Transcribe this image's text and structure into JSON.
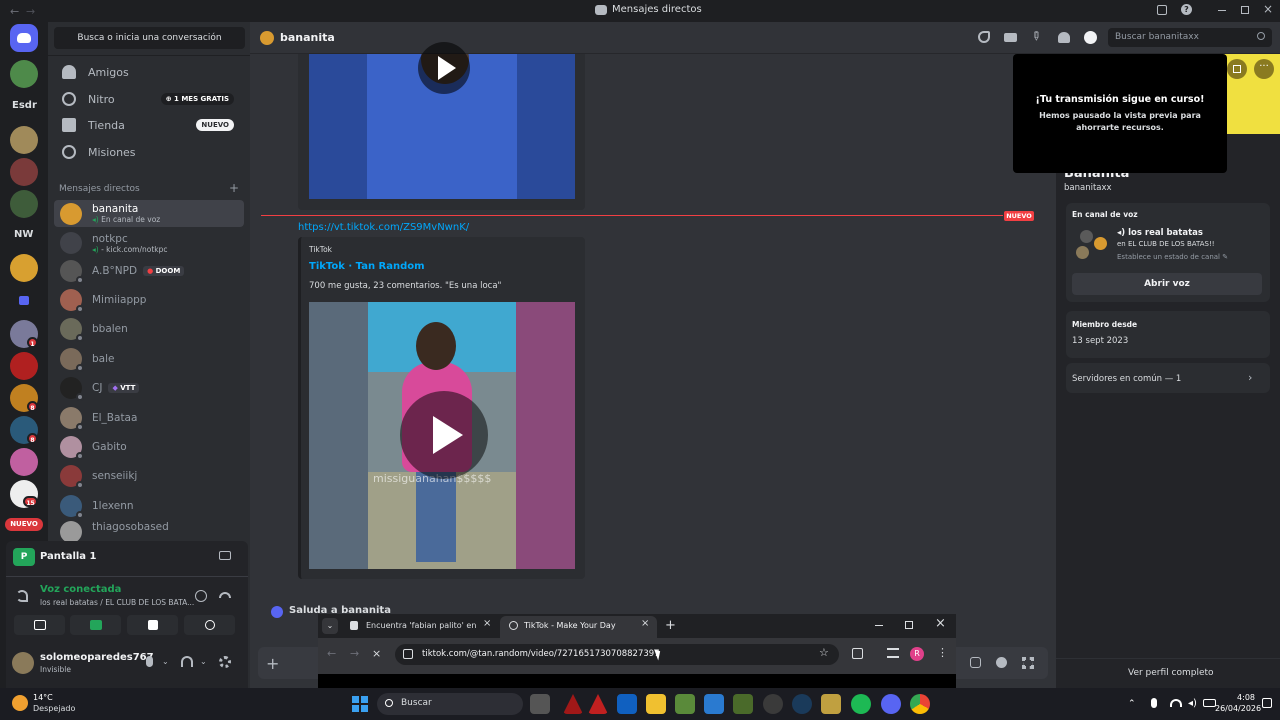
{
  "window": {
    "title": "Mensajes directos"
  },
  "guilds": {
    "items": [
      {
        "label": "",
        "color": "#5865f2"
      },
      {
        "label": "",
        "color": "#4e8a4a"
      },
      {
        "label": "Esdr",
        "color": "#1e1f22"
      },
      {
        "label": "",
        "color": "#a08a5a"
      },
      {
        "label": "",
        "color": "#7a3a3a"
      },
      {
        "label": "",
        "color": "#3e5c3a"
      },
      {
        "label": "NW",
        "color": "#1e1f22"
      },
      {
        "label": "",
        "color": "#d8a030"
      },
      {
        "label": "",
        "color": "#5865f2"
      },
      {
        "label": "",
        "color": "#7a7a9a",
        "badge": "1"
      },
      {
        "label": "",
        "color": "#b02020"
      },
      {
        "label": "",
        "color": "#c08020",
        "badge": "8"
      },
      {
        "label": "",
        "color": "#2a5a7a",
        "badge": "8"
      },
      {
        "label": "",
        "color": "#c060a0"
      },
      {
        "label": "",
        "color": "#eeeeee",
        "badge": "15"
      }
    ],
    "new_badge": "NUEVO"
  },
  "dmcol": {
    "search_placeholder": "Busca o inicia una conversación",
    "nav": [
      {
        "label": "Amigos",
        "icon": "friends-icon"
      },
      {
        "label": "Nitro",
        "icon": "nitro-icon",
        "tag": "⊕ 1 MES GRATIS"
      },
      {
        "label": "Tienda",
        "icon": "shop-icon",
        "tag": "NUEVO"
      },
      {
        "label": "Misiones",
        "icon": "quests-icon"
      }
    ],
    "dm_header": "Mensajes directos",
    "dms": [
      {
        "name": "bananita",
        "sub": "En canal de voz",
        "color": "#d89a30",
        "active": true
      },
      {
        "name": "notkpc",
        "sub": "- kick.com/notkpc",
        "color": "#404249"
      },
      {
        "name": "A.B°NPD",
        "badge": "DOOM",
        "color": "#555"
      },
      {
        "name": "Mimiiappp",
        "color": "#a06050"
      },
      {
        "name": "bbalen",
        "color": "#6a6a5a"
      },
      {
        "name": "bale",
        "color": "#7a6a5a"
      },
      {
        "name": "CJ",
        "badge": "VTT",
        "color": "#222"
      },
      {
        "name": "El_Bataa",
        "color": "#8a7a6a"
      },
      {
        "name": "Gabito",
        "color": "#b090a0"
      },
      {
        "name": "senseiikj",
        "color": "#8a3a3a"
      },
      {
        "name": "1lexenn",
        "color": "#3a5a7a"
      },
      {
        "name": "thiagosobased",
        "color": "#9a9a9a"
      }
    ]
  },
  "stream": {
    "name": "Pantalla 1"
  },
  "voice": {
    "status": "Voz conectada",
    "channel": "los real batatas / EL CLUB DE LOS BATA..."
  },
  "user": {
    "name": "solomeoparedes767",
    "status": "Invisible"
  },
  "header": {
    "name": "bananita",
    "search_placeholder": "Buscar bananitaxx"
  },
  "chat": {
    "new_label": "NUEVO",
    "link": "https://vt.tiktok.com/ZS9MvNwnK/",
    "embed": {
      "provider": "TikTok",
      "title": "TikTok · Tan Random",
      "description": "700 me gusta, 23 comentarios. \"Es una loca\"",
      "overlay_text": "missiguanahan$$$$$"
    },
    "wave": "Saluda a bananita"
  },
  "toast": {
    "title": "¡Tu transmisión sigue en curso!",
    "body": "Hemos pausado la vista previa para ahorrarte recursos."
  },
  "profile": {
    "display_name": "Bananita",
    "username": "bananitaxx",
    "voice_section": "En canal de voz",
    "voice_channel": "los real batatas",
    "voice_server": "en EL CLUB DE LOS BATAS!!",
    "voice_status": "Establece un estado de canal",
    "open_voice": "Abrir voz",
    "member_since_label": "Miembro desde",
    "member_since": "13 sept 2023",
    "common_servers": "Servidores en común — 1",
    "full_profile": "Ver perfil completo"
  },
  "browser": {
    "tabs": [
      {
        "label": "Encuentra 'fabian palito' en Tik"
      },
      {
        "label": "TikTok - Make Your Day"
      }
    ],
    "url": "tiktok.com/@tan.random/video/7271651730708827397",
    "profile_initial": "R"
  },
  "taskbar": {
    "weather_temp": "14°C",
    "weather_desc": "Despejado",
    "search": "Buscar",
    "time": "4:08",
    "date": "26/04/2026"
  },
  "colors": {
    "accent": "#5865f2",
    "link": "#00a8fc",
    "danger": "#f23f43",
    "green": "#23a55a",
    "yellow": "#f0e040"
  }
}
